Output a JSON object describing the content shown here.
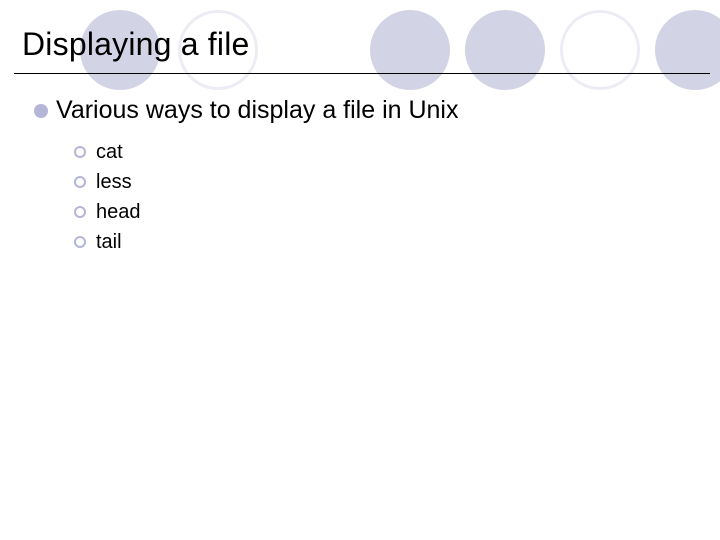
{
  "title": "Displaying a file",
  "bullet": {
    "heading": "Various ways to display a file in Unix",
    "items": [
      "cat",
      "less",
      "head",
      "tail"
    ]
  }
}
